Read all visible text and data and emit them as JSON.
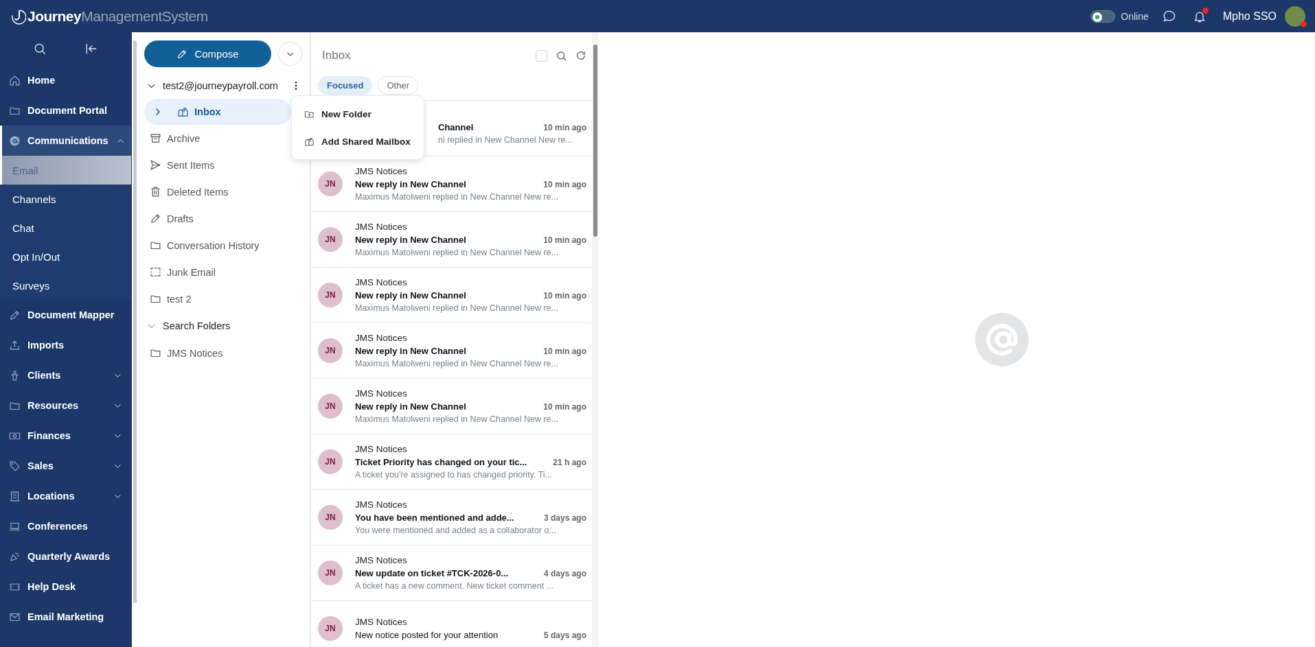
{
  "header": {
    "logo": {
      "bold": "Journey",
      "light": "ManagementSystem"
    },
    "status": {
      "label": "Online",
      "on": true
    },
    "notifications": {
      "unread": true
    },
    "user": {
      "name": "Mpho SSO",
      "online": true
    }
  },
  "sidebar": {
    "items": [
      {
        "label": "Home",
        "selected": false
      },
      {
        "label": "Document Portal",
        "selected": false
      },
      {
        "label": "Communications",
        "selected": true,
        "expanded": true,
        "children": [
          {
            "label": "Email",
            "selected": true
          },
          {
            "label": "Channels",
            "selected": false
          },
          {
            "label": "Chat",
            "selected": false
          },
          {
            "label": "Opt In/Out",
            "selected": false
          },
          {
            "label": "Surveys",
            "selected": false
          }
        ]
      },
      {
        "label": "Document Mapper",
        "selected": false
      },
      {
        "label": "Imports",
        "selected": false
      },
      {
        "label": "Clients",
        "selected": false,
        "expanded": false
      },
      {
        "label": "Resources",
        "selected": false,
        "expanded": false
      },
      {
        "label": "Finances",
        "selected": false,
        "expanded": false
      },
      {
        "label": "Sales",
        "selected": false,
        "expanded": false
      },
      {
        "label": "Locations",
        "selected": false,
        "expanded": false
      },
      {
        "label": "Conferences",
        "selected": false
      },
      {
        "label": "Quarterly Awards",
        "selected": false
      },
      {
        "label": "Help Desk",
        "selected": false
      },
      {
        "label": "Email Marketing",
        "selected": false
      }
    ]
  },
  "folder_pane": {
    "compose": {
      "label": "Compose"
    },
    "account": {
      "email": "test2@journeypayroll.com",
      "expanded": true
    },
    "folders": [
      {
        "label": "Inbox",
        "selected": true,
        "expanded": false
      },
      {
        "label": "Archive",
        "selected": false
      },
      {
        "label": "Sent Items",
        "selected": false
      },
      {
        "label": "Deleted Items",
        "selected": false
      },
      {
        "label": "Drafts",
        "selected": false
      },
      {
        "label": "Conversation History",
        "selected": false
      },
      {
        "label": "Junk Email",
        "selected": false
      },
      {
        "label": "test 2",
        "selected": false
      }
    ],
    "search_folders": {
      "label": "Search Folders",
      "expanded": true,
      "items": [
        {
          "label": "JMS Notices",
          "selected": false
        }
      ]
    },
    "context_menu": {
      "items": [
        {
          "label": "New Folder"
        },
        {
          "label": "Add Shared Mailbox"
        }
      ]
    }
  },
  "message_list": {
    "title": "Inbox",
    "select_all": {
      "checked": false
    },
    "tabs": [
      {
        "label": "Focused",
        "selected": true
      },
      {
        "label": "Other",
        "selected": false
      }
    ],
    "messages": [
      {
        "kind": "covered",
        "subject": "Channel",
        "time": "10 min ago",
        "preview": "ni replied in New Channel New re...",
        "unread": true
      },
      {
        "kind": "full",
        "avatar": "JN",
        "sender": "JMS Notices",
        "subject": "New reply in New Channel",
        "time": "10 min ago",
        "preview": "Maximus Matolweni replied in New Channel New re...",
        "unread": true
      },
      {
        "kind": "full",
        "avatar": "JN",
        "sender": "JMS Notices",
        "subject": "New reply in New Channel",
        "time": "10 min ago",
        "preview": "Maximus Matolweni replied in New Channel New re...",
        "unread": true
      },
      {
        "kind": "full",
        "avatar": "JN",
        "sender": "JMS Notices",
        "subject": "New reply in New Channel",
        "time": "10 min ago",
        "preview": "Maximus Matolweni replied in New Channel New re...",
        "unread": true
      },
      {
        "kind": "full",
        "avatar": "JN",
        "sender": "JMS Notices",
        "subject": "New reply in New Channel",
        "time": "10 min ago",
        "preview": "Maximus Matolweni replied in New Channel New re...",
        "unread": true
      },
      {
        "kind": "full",
        "avatar": "JN",
        "sender": "JMS Notices",
        "subject": "New reply in New Channel",
        "time": "10 min ago",
        "preview": "Maximus Matolweni replied in New Channel New re...",
        "unread": true
      },
      {
        "kind": "full",
        "avatar": "JN",
        "sender": "JMS Notices",
        "subject": "Ticket Priority has changed on your tic...",
        "time": "21 h ago",
        "preview": "A ticket you're assigned to has changed priority. Ti...",
        "unread": true
      },
      {
        "kind": "full",
        "avatar": "JN",
        "sender": "JMS Notices",
        "subject": "You have been mentioned and adde...",
        "time": "3 days ago",
        "preview": "You were mentioned and added as a collaborator o...",
        "unread": true
      },
      {
        "kind": "full",
        "avatar": "JN",
        "sender": "JMS Notices",
        "subject": "New update on ticket #TCK-2026-0...",
        "time": "4 days ago",
        "preview": "A ticket has a new comment. New ticket comment ...",
        "unread": true
      },
      {
        "kind": "full",
        "avatar": "JN",
        "sender": "JMS Notices",
        "subject": "New notice posted for your attention",
        "time": "5 days ago",
        "unread": false
      }
    ]
  }
}
